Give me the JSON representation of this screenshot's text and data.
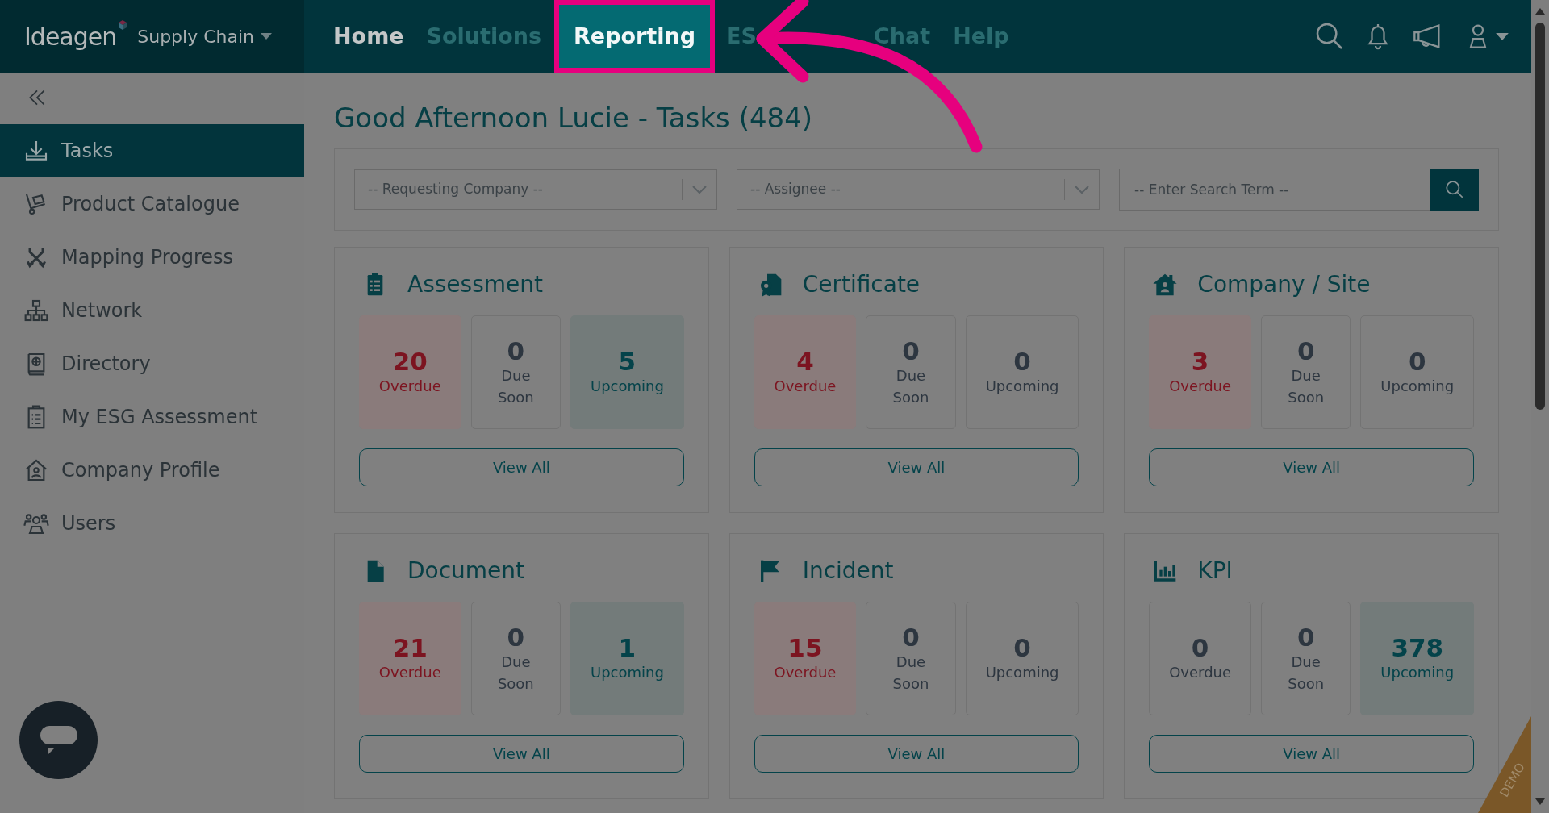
{
  "brand": {
    "logo": "Ideagen",
    "product": "Supply Chain"
  },
  "nav": [
    {
      "label": "Home",
      "selected": true,
      "highlighted": false
    },
    {
      "label": "Solutions",
      "selected": false,
      "highlighted": false
    },
    {
      "label": "Reporting",
      "selected": false,
      "highlighted": true
    },
    {
      "label": "ES",
      "selected": false,
      "highlighted": false
    },
    {
      "label": "Chat",
      "selected": false,
      "highlighted": false
    },
    {
      "label": "Help",
      "selected": false,
      "highlighted": false
    }
  ],
  "sidebar": {
    "items": [
      {
        "label": "Tasks",
        "selected": true
      },
      {
        "label": "Product Catalogue",
        "selected": false
      },
      {
        "label": "Mapping Progress",
        "selected": false
      },
      {
        "label": "Network",
        "selected": false
      },
      {
        "label": "Directory",
        "selected": false
      },
      {
        "label": "My ESG Assessment",
        "selected": false
      },
      {
        "label": "Company Profile",
        "selected": false
      },
      {
        "label": "Users",
        "selected": false
      }
    ]
  },
  "page_title": "Good Afternoon Lucie - Tasks (484)",
  "filters": {
    "company": {
      "placeholder": "-- Requesting Company --"
    },
    "assignee": {
      "placeholder": "-- Assignee --"
    },
    "search": {
      "placeholder": "-- Enter Search Term --"
    }
  },
  "cards": [
    {
      "title": "Assessment",
      "stats": [
        {
          "kind": "overdue",
          "value": "20",
          "label": "Overdue",
          "highlighted": true
        },
        {
          "kind": "due_soon",
          "value": "0",
          "label": "Due Soon",
          "highlighted": false
        },
        {
          "kind": "upcoming",
          "value": "5",
          "label": "Upcoming",
          "highlighted": true
        }
      ],
      "button": "View All"
    },
    {
      "title": "Certificate",
      "stats": [
        {
          "kind": "overdue",
          "value": "4",
          "label": "Overdue",
          "highlighted": true
        },
        {
          "kind": "due_soon",
          "value": "0",
          "label": "Due Soon",
          "highlighted": false
        },
        {
          "kind": "upcoming",
          "value": "0",
          "label": "Upcoming",
          "highlighted": false
        }
      ],
      "button": "View All"
    },
    {
      "title": "Company / Site",
      "stats": [
        {
          "kind": "overdue",
          "value": "3",
          "label": "Overdue",
          "highlighted": true
        },
        {
          "kind": "due_soon",
          "value": "0",
          "label": "Due Soon",
          "highlighted": false
        },
        {
          "kind": "upcoming",
          "value": "0",
          "label": "Upcoming",
          "highlighted": false
        }
      ],
      "button": "View All"
    },
    {
      "title": "Document",
      "stats": [
        {
          "kind": "overdue",
          "value": "21",
          "label": "Overdue",
          "highlighted": true
        },
        {
          "kind": "due_soon",
          "value": "0",
          "label": "Due Soon",
          "highlighted": false
        },
        {
          "kind": "upcoming",
          "value": "1",
          "label": "Upcoming",
          "highlighted": true
        }
      ],
      "button": "View All"
    },
    {
      "title": "Incident",
      "stats": [
        {
          "kind": "overdue",
          "value": "15",
          "label": "Overdue",
          "highlighted": true
        },
        {
          "kind": "due_soon",
          "value": "0",
          "label": "Due Soon",
          "highlighted": false
        },
        {
          "kind": "upcoming",
          "value": "0",
          "label": "Upcoming",
          "highlighted": false
        }
      ],
      "button": "View All"
    },
    {
      "title": "KPI",
      "stats": [
        {
          "kind": "overdue",
          "value": "0",
          "label": "Overdue",
          "highlighted": false
        },
        {
          "kind": "due_soon",
          "value": "0",
          "label": "Due Soon",
          "highlighted": false
        },
        {
          "kind": "upcoming",
          "value": "378",
          "label": "Upcoming",
          "highlighted": true
        }
      ],
      "button": "View All"
    }
  ],
  "ribbon": "DEMO"
}
